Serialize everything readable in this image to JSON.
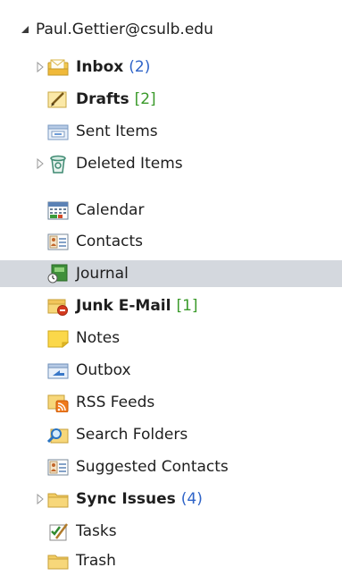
{
  "account": {
    "label": "Paul.Gettier@csulb.edu",
    "icon": "collapse-triangle-icon"
  },
  "folders": [
    {
      "name": "Inbox",
      "bold": true,
      "count": "(2)",
      "count_color": "#2f64c8",
      "has_children": true,
      "icon": "inbox-icon"
    },
    {
      "name": "Drafts",
      "bold": true,
      "count": "[2]",
      "count_color": "#3a9a2a",
      "has_children": false,
      "icon": "drafts-icon"
    },
    {
      "name": "Sent Items",
      "bold": false,
      "count": "",
      "has_children": false,
      "icon": "sent-items-icon"
    },
    {
      "name": "Deleted Items",
      "bold": false,
      "count": "",
      "has_children": true,
      "icon": "deleted-items-icon"
    },
    {
      "name": "Calendar",
      "bold": false,
      "count": "",
      "has_children": false,
      "icon": "calendar-icon"
    },
    {
      "name": "Contacts",
      "bold": false,
      "count": "",
      "has_children": false,
      "icon": "contacts-icon"
    },
    {
      "name": "Journal",
      "bold": false,
      "count": "",
      "has_children": false,
      "selected": true,
      "icon": "journal-icon"
    },
    {
      "name": "Junk E-Mail",
      "bold": true,
      "count": "[1]",
      "count_color": "#3a9a2a",
      "has_children": false,
      "icon": "junk-email-icon"
    },
    {
      "name": "Notes",
      "bold": false,
      "count": "",
      "has_children": false,
      "icon": "notes-icon"
    },
    {
      "name": "Outbox",
      "bold": false,
      "count": "",
      "has_children": false,
      "icon": "outbox-icon"
    },
    {
      "name": "RSS Feeds",
      "bold": false,
      "count": "",
      "has_children": false,
      "icon": "rss-feeds-icon"
    },
    {
      "name": "Search Folders",
      "bold": false,
      "count": "",
      "has_children": false,
      "icon": "search-folders-icon"
    },
    {
      "name": "Suggested Contacts",
      "bold": false,
      "count": "",
      "has_children": false,
      "icon": "suggested-contacts-icon"
    },
    {
      "name": "Sync Issues",
      "bold": true,
      "count": "(4)",
      "count_color": "#2f64c8",
      "has_children": true,
      "icon": "sync-issues-icon"
    },
    {
      "name": "Tasks",
      "bold": false,
      "count": "",
      "has_children": false,
      "icon": "tasks-icon"
    },
    {
      "name": "Trash",
      "bold": false,
      "count": "",
      "has_children": false,
      "icon": "trash-icon"
    }
  ],
  "colors": {
    "selection": "#d4d8de",
    "unread_count": "#2f64c8",
    "item_count": "#3a9a2a"
  }
}
